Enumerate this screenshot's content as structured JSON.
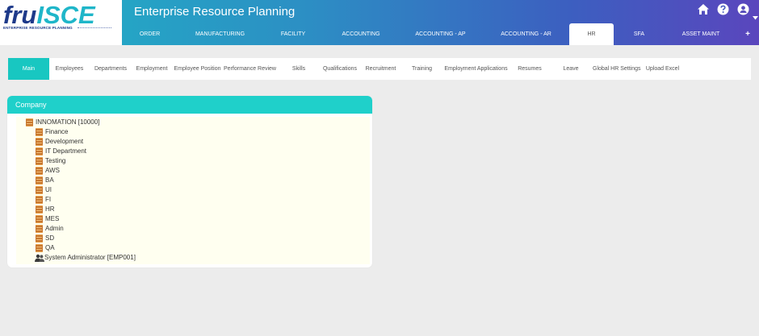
{
  "brand": {
    "logo_main": "fru",
    "logo_accent": "ISCE",
    "tagline": "ENTERPRISE RESOURCE PLANNING"
  },
  "app": {
    "title": "Enterprise Resource Planning"
  },
  "topnav": {
    "items": [
      "ORDER",
      "MANUFACTURING",
      "FACILITY",
      "ACCOUNTING",
      "ACCOUNTING - AP",
      "ACCOUNTING - AR",
      "HR",
      "SFA",
      "ASSET MAINT",
      "+"
    ],
    "active": "HR"
  },
  "subtabs": {
    "items": [
      "Main",
      "Employees",
      "Departments",
      "Employment",
      "Employee Position",
      "Performance Review",
      "Skills",
      "Qualifications",
      "Recruitment",
      "Training",
      "Employment Applications",
      "Resumes",
      "Leave",
      "Global HR Settings",
      "Upload Excel"
    ],
    "active": "Main"
  },
  "panel": {
    "title": "Company",
    "root": "INNOMATION [10000]",
    "departments": [
      "Finance",
      "Development",
      "IT Department",
      "Testing",
      "AWS",
      "BA",
      "UI",
      "FI",
      "HR",
      "MES",
      "Admin",
      "SD",
      "QA"
    ],
    "user": "System Administrator [EMP001]"
  },
  "colors": {
    "accent": "#1fd0ca",
    "tab_active": "#18c7c1",
    "tree_bg": "#fffff0",
    "header_start": "#20b3c6",
    "header_end": "#5a46bd"
  },
  "icons": {
    "home": "home-icon",
    "help": "help-icon",
    "user": "user-circle-icon",
    "caret": "caret-down-icon",
    "folder": "book-icon",
    "person": "people-icon"
  }
}
